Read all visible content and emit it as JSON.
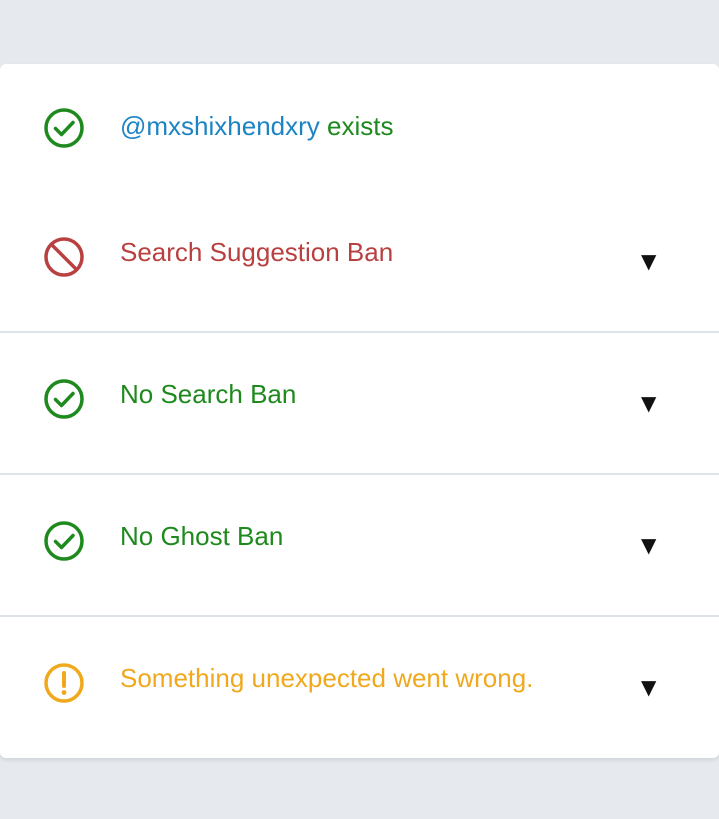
{
  "colors": {
    "ok": "#1e8a1e",
    "ban": "#b94040",
    "warn": "#f0a81c",
    "handle": "#1d84c4",
    "page_bg": "#e6eaee"
  },
  "rows": [
    {
      "handle": "@mxshixhendxry",
      "label": " exists",
      "icon": "check-circle-icon",
      "status": "ok"
    },
    {
      "label": "Search Suggestion Ban",
      "icon": "ban-icon",
      "status": "ban",
      "toggle": "▼"
    },
    {
      "label": "No Search Ban",
      "icon": "check-circle-icon",
      "status": "ok",
      "toggle": "▼"
    },
    {
      "label": "No Ghost Ban",
      "icon": "check-circle-icon",
      "status": "ok",
      "toggle": "▼"
    },
    {
      "label": "Something unexpected went wrong.",
      "icon": "warning-circle-icon",
      "status": "warn",
      "toggle": "▼"
    }
  ]
}
